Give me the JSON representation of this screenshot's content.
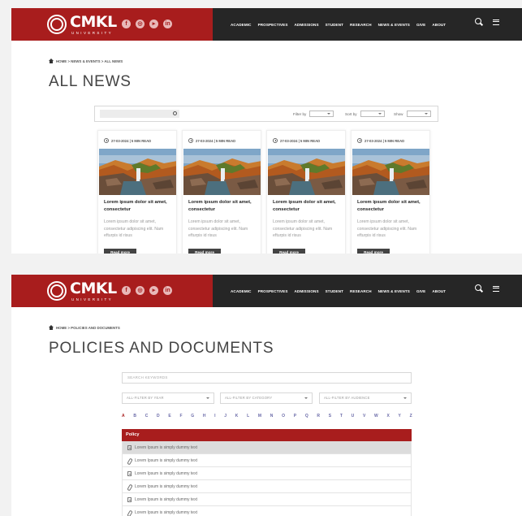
{
  "brand": {
    "name": "CMKL",
    "subtitle": "UNIVERSITY",
    "accent": "#a81d1d",
    "nav_bg": "#262626"
  },
  "header": {
    "social_icons": [
      "facebook-icon",
      "instagram-icon",
      "youtube-icon",
      "linkedin-icon"
    ],
    "nav": [
      "ACADEMIC",
      "PROSPECTIVES",
      "ADMISSIONS",
      "STUDENT",
      "RESEARCH",
      "NEWS & EVENTS",
      "GIVE",
      "ABOUT"
    ]
  },
  "news_page": {
    "breadcrumb": "HOME > NEWS & EVENTS > ALL NEWS",
    "title": "ALL NEWS",
    "filters": {
      "filter_by": "Filter by",
      "sort_by": "Sort by",
      "show": "Show"
    },
    "cards": [
      {
        "meta": "27-03-2024  |  5 MIN READ",
        "title": "Lorem ipsum dolor sit amet, consectetur",
        "text": "Lorem ipsum dolor sit amet, consectetur adipiscing elit. Nam efturpis id risus",
        "button": "Read more"
      },
      {
        "meta": "27-03-2024  |  5 MIN READ",
        "title": "Lorem ipsum dolor sit amet, consectetur",
        "text": "Lorem ipsum dolor sit amet, consectetur adipiscing elit. Nam efturpis id risus",
        "button": "Read more"
      },
      {
        "meta": "27-03-2024  |  5 MIN READ",
        "title": "Lorem ipsum dolor sit amet, consectetur",
        "text": "Lorem ipsum dolor sit amet, consectetur adipiscing elit. Nam efturpis id risus",
        "button": "Read more"
      },
      {
        "meta": "27-03-2024  |  5 MIN READ",
        "title": "Lorem ipsum dolor sit amet, consectetur",
        "text": "Lorem ipsum dolor sit amet, consectetur adipiscing elit. Nam efturpis id risus",
        "button": "Read more"
      }
    ]
  },
  "policies_page": {
    "breadcrumb": "HOME > POLICIES AND DOCUMENTS",
    "title": "POLICIES AND DOCUMENTS",
    "search_placeholder": "SEARCH KEYWORDS",
    "selects": [
      "ALL-FILTER BY YEAR",
      "ALL-FILTER BY CATEGORY",
      "ALL-FILTER BY AUDIENCE"
    ],
    "alphabet": [
      "A",
      "B",
      "C",
      "D",
      "E",
      "F",
      "G",
      "H",
      "I",
      "J",
      "K",
      "L",
      "M",
      "N",
      "O",
      "P",
      "Q",
      "R",
      "S",
      "T",
      "U",
      "V",
      "W",
      "X",
      "Y",
      "Z"
    ],
    "active_letter": "A",
    "table_header": "Policy",
    "rows": [
      {
        "icon": "document-icon",
        "text": "Lorem Ipsum is simply dummy text",
        "highlight": true
      },
      {
        "icon": "paperclip-icon",
        "text": "Lorem Ipsum is simply dummy text",
        "highlight": false
      },
      {
        "icon": "document-icon",
        "text": "Lorem Ipsum is simply dummy text",
        "highlight": false
      },
      {
        "icon": "paperclip-icon",
        "text": "Lorem Ipsum is simply dummy text",
        "highlight": false
      },
      {
        "icon": "document-icon",
        "text": "Lorem Ipsum is simply dummy text",
        "highlight": false
      },
      {
        "icon": "paperclip-icon",
        "text": "Lorem Ipsum is simply dummy text",
        "highlight": false
      }
    ]
  }
}
